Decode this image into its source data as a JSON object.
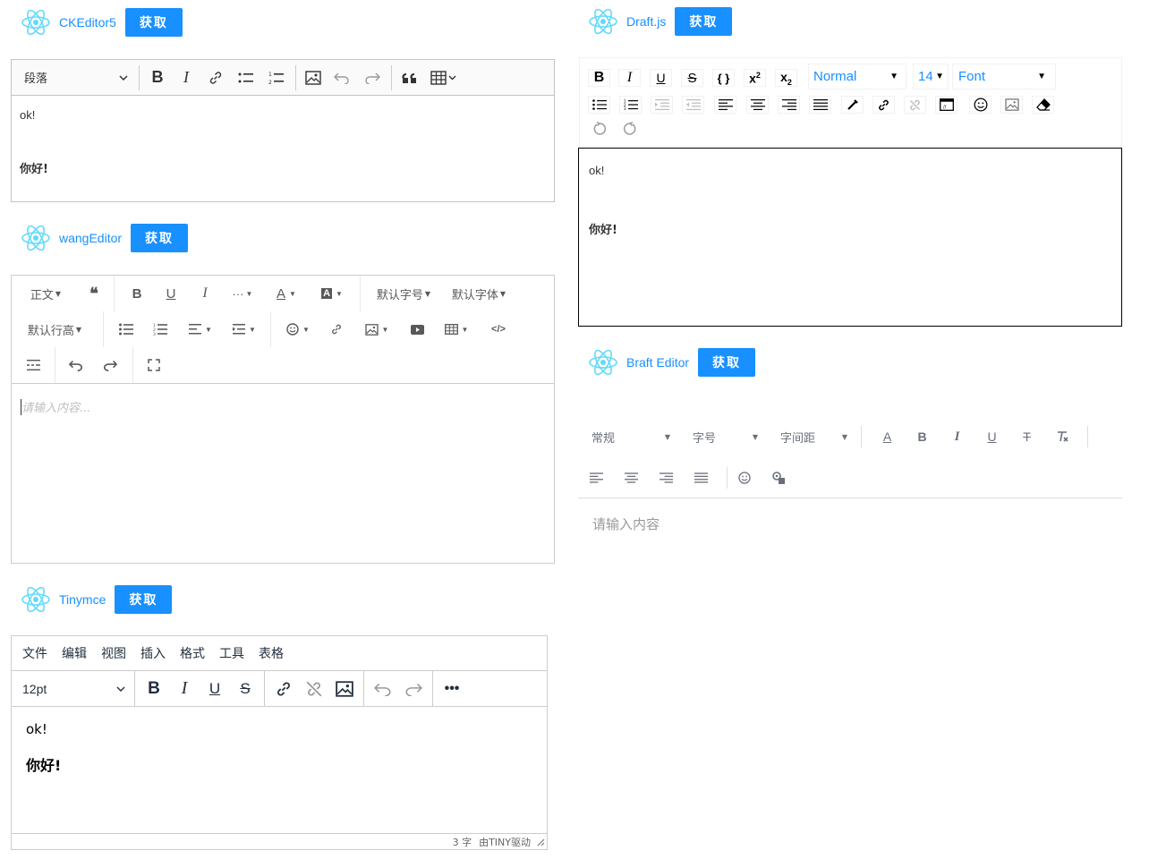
{
  "ckeditor": {
    "title": "CKEditor5",
    "get_button": "获取",
    "heading_select": "段落",
    "content_line1": "ok!",
    "content_line2": "你好!"
  },
  "wang": {
    "title": "wangEditor",
    "get_button": "获取",
    "toolbar": {
      "paragraph": "正文",
      "font_size": "默认字号",
      "font_family": "默认字体",
      "line_height": "默认行高",
      "more": "···"
    },
    "placeholder": "请输入内容..."
  },
  "tiny": {
    "title": "Tinymce",
    "get_button": "获取",
    "menu": [
      "文件",
      "编辑",
      "视图",
      "插入",
      "格式",
      "工具",
      "表格"
    ],
    "font_size": "12pt",
    "content_line1": "ok!",
    "content_line2": "你好!",
    "word_count": "3 字",
    "powered": "由TINY驱动"
  },
  "draft": {
    "title": "Draft.js",
    "get_button": "获取",
    "block_type": "Normal",
    "font_size": "14",
    "font_family": "Font",
    "content_line1": "ok!",
    "content_line2": "你好!"
  },
  "braft": {
    "title": "Braft Editor",
    "get_button": "获取",
    "heading": "常规",
    "font_size": "字号",
    "letter_spacing": "字间距",
    "placeholder": "请输入内容"
  },
  "colors": {
    "accent": "#1890ff",
    "react_logo": "#61dafb"
  }
}
